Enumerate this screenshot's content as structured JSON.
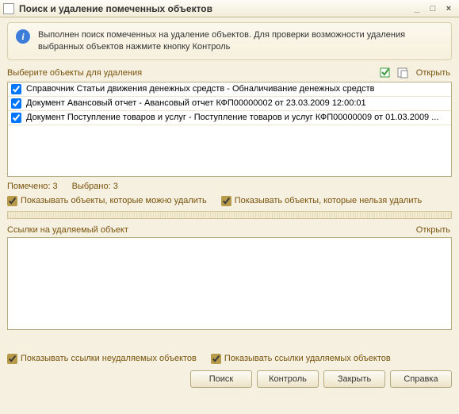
{
  "titlebar": {
    "title": "Поиск и удаление помеченных объектов"
  },
  "info": {
    "text": "Выполнен поиск помеченных на удаление объектов. Для проверки возможности удаления выбранных объектов нажмите кнопку Контроль"
  },
  "selectlabel": "Выберите объекты для удаления",
  "open_label": "Открыть",
  "list": {
    "items": [
      {
        "checked": true,
        "text": "Справочник Статьи движения денежных средств - Обналичивание денежных средств"
      },
      {
        "checked": true,
        "text": "Документ Авансовый отчет - Авансовый отчет КФП00000002 от 23.03.2009 12:00:01"
      },
      {
        "checked": true,
        "text": "Документ Поступление товаров и услуг - Поступление товаров и услуг КФП00000009 от 01.03.2009 ..."
      }
    ]
  },
  "status": {
    "marked_label": "Помечено:",
    "marked_value": "3",
    "selected_label": "Выбрано:",
    "selected_value": "3"
  },
  "filters": {
    "deletable": "Показывать объекты, которые можно удалить",
    "undeletable": "Показывать объекты, которые нельзя удалить"
  },
  "refs": {
    "header": "Ссылки на удаляемый объект"
  },
  "bottom": {
    "nondel": "Показывать ссылки неудаляемых объектов",
    "del": "Показывать ссылки удаляемых объектов"
  },
  "buttons": {
    "search": "Поиск",
    "control": "Контроль",
    "close": "Закрыть",
    "help": "Справка"
  }
}
